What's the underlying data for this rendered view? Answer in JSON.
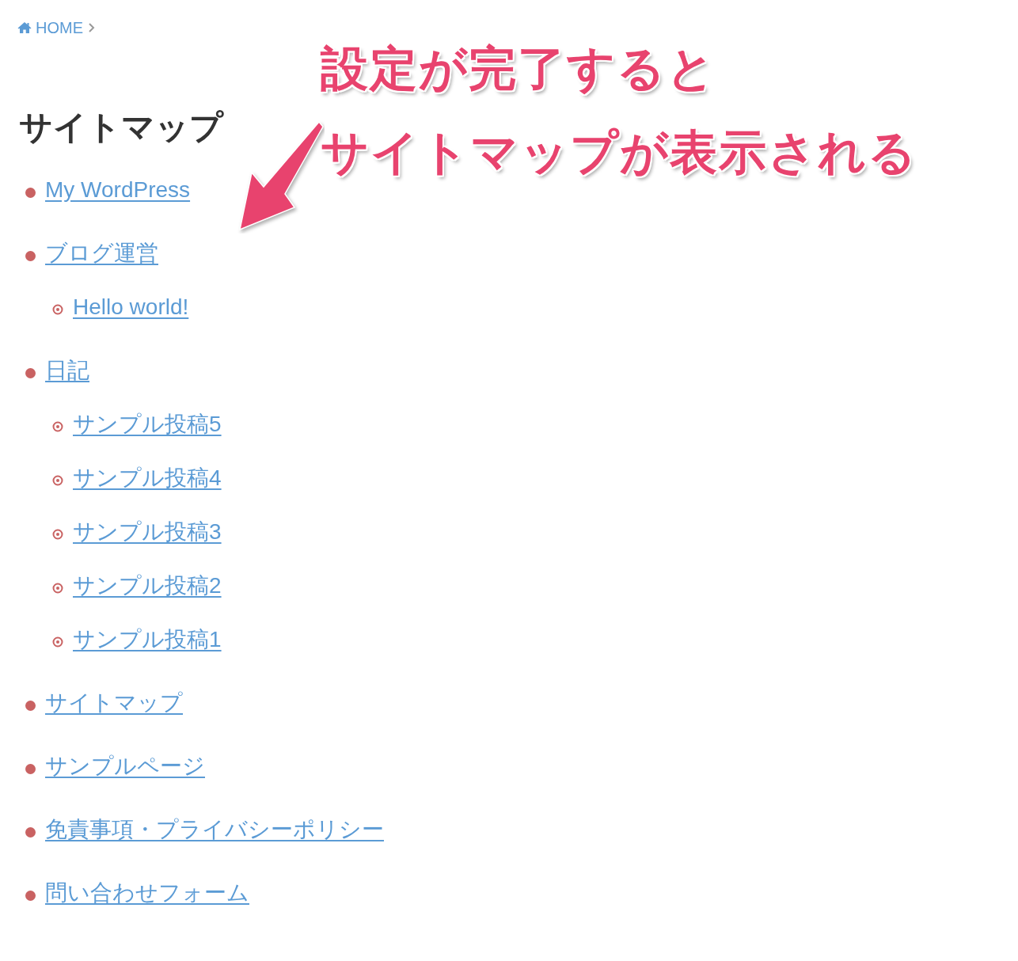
{
  "breadcrumb": {
    "home": "HOME"
  },
  "title": "サイトマップ",
  "annotation": {
    "lines": [
      "設定が完了すると",
      "サイトマップが表示される"
    ]
  },
  "sitemap": [
    {
      "label": "My WordPress"
    },
    {
      "label": "ブログ運営",
      "children": [
        {
          "label": "Hello world!"
        }
      ]
    },
    {
      "label": "日記",
      "children": [
        {
          "label": "サンプル投稿5"
        },
        {
          "label": "サンプル投稿4"
        },
        {
          "label": "サンプル投稿3"
        },
        {
          "label": "サンプル投稿2"
        },
        {
          "label": "サンプル投稿1"
        }
      ]
    },
    {
      "label": "サイトマップ"
    },
    {
      "label": "サンプルページ"
    },
    {
      "label": "免責事項・プライバシーポリシー"
    },
    {
      "label": "問い合わせフォーム"
    }
  ]
}
